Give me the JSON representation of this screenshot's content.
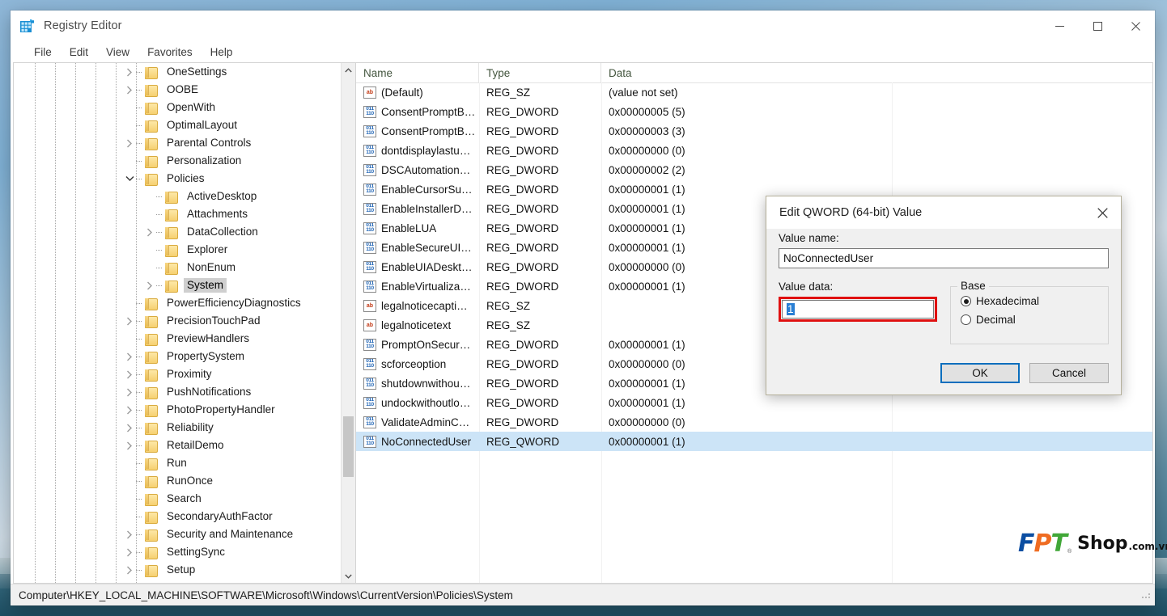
{
  "window": {
    "title": "Registry Editor",
    "icon": "registry-editor-icon",
    "controls": {
      "minimize": "—",
      "maximize": "□",
      "close": "✕"
    }
  },
  "menubar": {
    "items": [
      "File",
      "Edit",
      "View",
      "Favorites",
      "Help"
    ]
  },
  "tree": {
    "scrollbar": {
      "up": "▲",
      "down": "▼"
    },
    "items": [
      {
        "label": "OneSettings",
        "depth": 1,
        "twisty": "collapsed"
      },
      {
        "label": "OOBE",
        "depth": 1,
        "twisty": "collapsed"
      },
      {
        "label": "OpenWith",
        "depth": 1,
        "twisty": "none"
      },
      {
        "label": "OptimalLayout",
        "depth": 1,
        "twisty": "none"
      },
      {
        "label": "Parental Controls",
        "depth": 1,
        "twisty": "collapsed"
      },
      {
        "label": "Personalization",
        "depth": 1,
        "twisty": "none"
      },
      {
        "label": "Policies",
        "depth": 1,
        "twisty": "expanded"
      },
      {
        "label": "ActiveDesktop",
        "depth": 2,
        "twisty": "none"
      },
      {
        "label": "Attachments",
        "depth": 2,
        "twisty": "none"
      },
      {
        "label": "DataCollection",
        "depth": 2,
        "twisty": "collapsed"
      },
      {
        "label": "Explorer",
        "depth": 2,
        "twisty": "none"
      },
      {
        "label": "NonEnum",
        "depth": 2,
        "twisty": "none"
      },
      {
        "label": "System",
        "depth": 2,
        "twisty": "collapsed",
        "selected": true
      },
      {
        "label": "PowerEfficiencyDiagnostics",
        "depth": 1,
        "twisty": "none"
      },
      {
        "label": "PrecisionTouchPad",
        "depth": 1,
        "twisty": "collapsed"
      },
      {
        "label": "PreviewHandlers",
        "depth": 1,
        "twisty": "none"
      },
      {
        "label": "PropertySystem",
        "depth": 1,
        "twisty": "collapsed"
      },
      {
        "label": "Proximity",
        "depth": 1,
        "twisty": "collapsed"
      },
      {
        "label": "PushNotifications",
        "depth": 1,
        "twisty": "collapsed"
      },
      {
        "label": "PhotoPropertyHandler",
        "depth": 1,
        "twisty": "collapsed"
      },
      {
        "label": "Reliability",
        "depth": 1,
        "twisty": "collapsed"
      },
      {
        "label": "RetailDemo",
        "depth": 1,
        "twisty": "collapsed"
      },
      {
        "label": "Run",
        "depth": 1,
        "twisty": "none"
      },
      {
        "label": "RunOnce",
        "depth": 1,
        "twisty": "none"
      },
      {
        "label": "Search",
        "depth": 1,
        "twisty": "none"
      },
      {
        "label": "SecondaryAuthFactor",
        "depth": 1,
        "twisty": "none"
      },
      {
        "label": "Security and Maintenance",
        "depth": 1,
        "twisty": "collapsed"
      },
      {
        "label": "SettingSync",
        "depth": 1,
        "twisty": "collapsed"
      },
      {
        "label": "Setup",
        "depth": 1,
        "twisty": "collapsed"
      }
    ]
  },
  "list": {
    "columns": [
      "Name",
      "Type",
      "Data"
    ],
    "rows": [
      {
        "icon": "string-value-icon",
        "name": "(Default)",
        "type": "REG_SZ",
        "data": "(value not set)"
      },
      {
        "icon": "dword-value-icon",
        "name": "ConsentPromptB…",
        "type": "REG_DWORD",
        "data": "0x00000005 (5)"
      },
      {
        "icon": "dword-value-icon",
        "name": "ConsentPromptB…",
        "type": "REG_DWORD",
        "data": "0x00000003 (3)"
      },
      {
        "icon": "dword-value-icon",
        "name": "dontdisplaylastu…",
        "type": "REG_DWORD",
        "data": "0x00000000 (0)"
      },
      {
        "icon": "dword-value-icon",
        "name": "DSCAutomation…",
        "type": "REG_DWORD",
        "data": "0x00000002 (2)"
      },
      {
        "icon": "dword-value-icon",
        "name": "EnableCursorSu…",
        "type": "REG_DWORD",
        "data": "0x00000001 (1)"
      },
      {
        "icon": "dword-value-icon",
        "name": "EnableInstallerD…",
        "type": "REG_DWORD",
        "data": "0x00000001 (1)"
      },
      {
        "icon": "dword-value-icon",
        "name": "EnableLUA",
        "type": "REG_DWORD",
        "data": "0x00000001 (1)"
      },
      {
        "icon": "dword-value-icon",
        "name": "EnableSecureUI…",
        "type": "REG_DWORD",
        "data": "0x00000001 (1)"
      },
      {
        "icon": "dword-value-icon",
        "name": "EnableUIADeskt…",
        "type": "REG_DWORD",
        "data": "0x00000000 (0)"
      },
      {
        "icon": "dword-value-icon",
        "name": "EnableVirtualiza…",
        "type": "REG_DWORD",
        "data": "0x00000001 (1)"
      },
      {
        "icon": "string-value-icon",
        "name": "legalnoticecapti…",
        "type": "REG_SZ",
        "data": ""
      },
      {
        "icon": "string-value-icon",
        "name": "legalnoticetext",
        "type": "REG_SZ",
        "data": ""
      },
      {
        "icon": "dword-value-icon",
        "name": "PromptOnSecur…",
        "type": "REG_DWORD",
        "data": "0x00000001 (1)"
      },
      {
        "icon": "dword-value-icon",
        "name": "scforceoption",
        "type": "REG_DWORD",
        "data": "0x00000000 (0)"
      },
      {
        "icon": "dword-value-icon",
        "name": "shutdownwithou…",
        "type": "REG_DWORD",
        "data": "0x00000001 (1)"
      },
      {
        "icon": "dword-value-icon",
        "name": "undockwithoutlo…",
        "type": "REG_DWORD",
        "data": "0x00000001 (1)"
      },
      {
        "icon": "dword-value-icon",
        "name": "ValidateAdminC…",
        "type": "REG_DWORD",
        "data": "0x00000000 (0)"
      },
      {
        "icon": "qword-value-icon",
        "name": "NoConnectedUser",
        "type": "REG_QWORD",
        "data": "0x00000001 (1)",
        "selected": true
      }
    ]
  },
  "statusbar": {
    "path": "Computer\\HKEY_LOCAL_MACHINE\\SOFTWARE\\Microsoft\\Windows\\CurrentVersion\\Policies\\System"
  },
  "dialog": {
    "title": "Edit QWORD (64-bit) Value",
    "close_icon": "✕",
    "value_name_label": "Value name:",
    "value_name": "NoConnectedUser",
    "value_data_label": "Value data:",
    "value_data": "1",
    "base_legend": "Base",
    "base_options": [
      {
        "label": "Hexadecimal",
        "checked": true
      },
      {
        "label": "Decimal",
        "checked": false
      }
    ],
    "ok_label": "OK",
    "cancel_label": "Cancel",
    "highlight_color": "#e01010"
  },
  "watermark": {
    "f": "F",
    "p": "P",
    "t": "T",
    "reg": "®",
    "shop": "Shop",
    "tld": ".com.vn"
  }
}
